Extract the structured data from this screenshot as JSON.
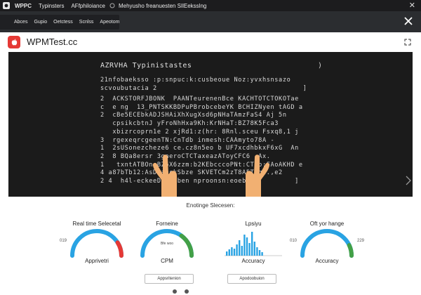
{
  "top_bar": {
    "app_name": "WPPC",
    "menu": [
      "Typinsters",
      "AFfphiloiance",
      "Mehyusho freanuesten SIlEeksslng"
    ]
  },
  "nav_bar": {
    "tabs": [
      "Abces",
      "Gupio",
      "Oetctess",
      "Scnlss",
      "Apeotom"
    ]
  },
  "site": {
    "name": "WPMTest.cc"
  },
  "typing_panel": {
    "title": "AZRVHA Typinistastes",
    "bracket": ")",
    "lines": [
      "21nfobaeksso :p:snpuc:k:cusbeoue Noz:yvxhsnsazo",
      "scvoubutacia 2                                    ]",
      "2  ACKSTORFJBONK  PAANTeurenenBce KACHTOTCTOKOTae",
      "c  e ng  13_PNTSKKBDPuPBrobcebeYK BCHIZNyen tAGD a",
      "2  cBe5ECEbkADJSHAiXhXugXsd6pNHaTAmzFaS4 Aj 5n",
      "   cpsikcbtnJ yFroNhHxa9Kh:KrNHaT:BZ78K5Fca3",
      "   xbizrcoprn1e 2 xjRd1:z(hr: 8Rnl.sceu Fsxq8,1 j",
      "3  rgexeqrcgeenTN:CnTdb inmesh:CAAmyto78A -",
      "1  2sUSonezcheze6 ce.cz8n5eo b UF7xcdhbkxF6xG  An",
      "2  8 BQa8ersr 3gaeroCTCTaxeazAToyCFC6  Ax.",
      "1   txntATBOneBZ6X6zzm:b2KEbcccoPNt:CTgo:FAoAKHD e",
      "4 a87bTb12:AsD1aeckSbze SKVETCm2zT8A5TSq8.,e2",
      "2 4  h4l-eckeeDBal ben nproonsn:eoebs.          ]"
    ]
  },
  "section_title": "Enotinge Slecesen:",
  "gauges": [
    {
      "title": "Real time Selecetal",
      "label": "Apprivetri",
      "left_value": "019",
      "right_value": "",
      "center_value": "",
      "color": "#e53935",
      "fill": 0.82
    },
    {
      "title": "Forneine",
      "label": "CPM",
      "left_value": "",
      "right_value": "",
      "center_value": "Bfe woo",
      "color": "#43a047",
      "fill": 0.7
    },
    {
      "title": "Lpsiyu",
      "label": "Accuracy",
      "left_value": "",
      "right_value": "",
      "center_value": "",
      "color": "#1e88e5",
      "fill": 0.0
    },
    {
      "title": "Oft yor hange",
      "label": "Accuracy",
      "left_value": "010",
      "right_value": "229",
      "center_value": "",
      "color": "#43a047",
      "fill": 0.86
    }
  ],
  "buttons": [
    "Appsritenion",
    "Apodoobuion"
  ],
  "colors": {
    "primary_blue": "#29a3e3",
    "alert_red": "#e53935",
    "success_green": "#43a047",
    "panel_bg": "#1b1b1b"
  }
}
